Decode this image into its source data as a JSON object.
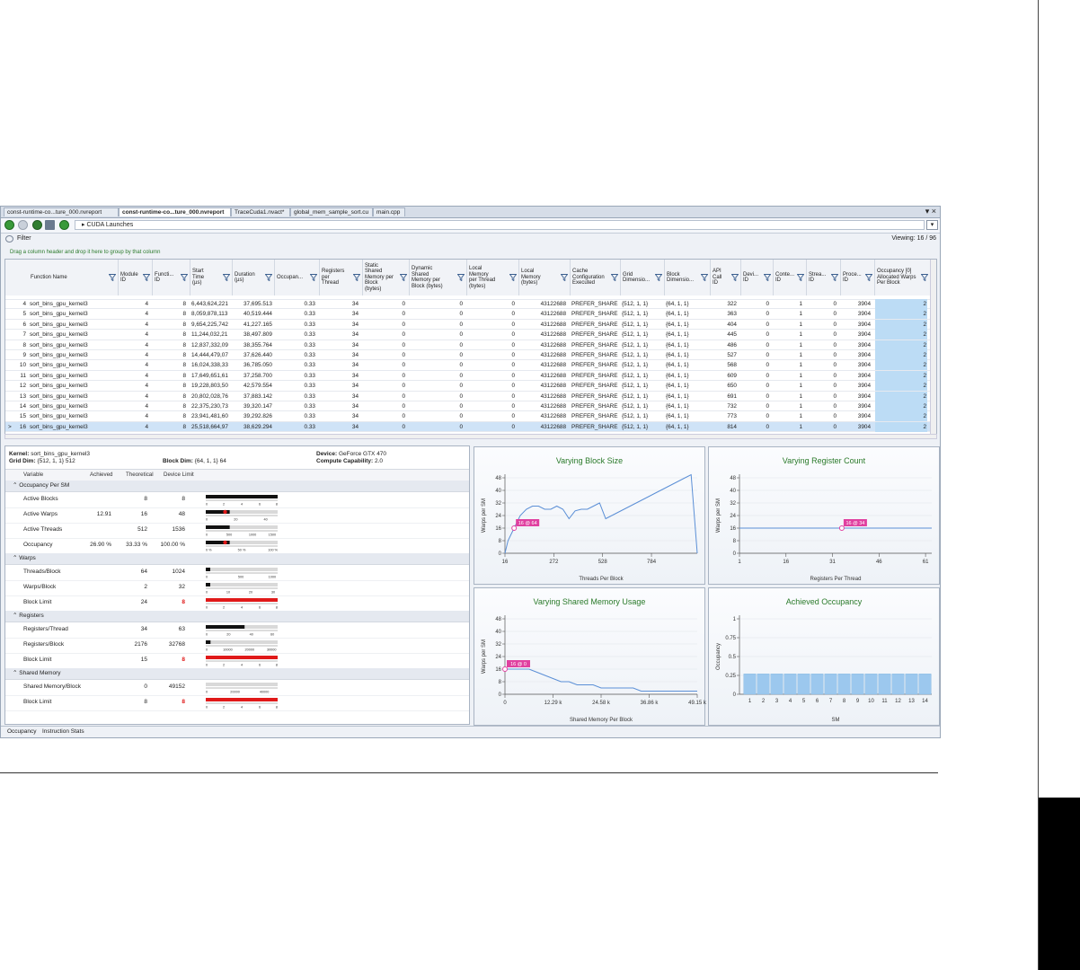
{
  "tabs": [
    {
      "label": "const-runtime-co...ture_000.nvreport",
      "active": false
    },
    {
      "label": "const-runtime-co...ture_000.nvreport",
      "active": true
    },
    {
      "label": "TraceCuda1.nvact*",
      "active": false
    },
    {
      "label": "global_mem_sample_sort.cu",
      "active": false
    },
    {
      "label": "main.cpp",
      "active": false
    }
  ],
  "window_controls": "▾ ×",
  "breadcrumb": "CUDA Launches",
  "filter": {
    "label": "Filter",
    "viewing": "Viewing: 16 / 96",
    "group_hint": "Drag a column header and drop it here to group by that column"
  },
  "grid": {
    "columns": [
      {
        "label": "Function Name"
      },
      {
        "label": "Module\nID"
      },
      {
        "label": "Functi...\nID"
      },
      {
        "label": "Start\nTime\n(µs)"
      },
      {
        "label": "Duration\n(µs)"
      },
      {
        "label": "Occupan..."
      },
      {
        "label": "Registers\nper\nThread"
      },
      {
        "label": "Static\nShared\nMemory per\nBlock\n(bytes)"
      },
      {
        "label": "Dynamic\nShared\nMemory per\nBlock (bytes)"
      },
      {
        "label": "Local\nMemory\nper Thread\n(bytes)"
      },
      {
        "label": "Local\nMemory\n(bytes)"
      },
      {
        "label": "Cache\nConfiguration\nExecuted"
      },
      {
        "label": "Grid\nDimensio..."
      },
      {
        "label": "Block\nDimensio..."
      },
      {
        "label": "API\nCall\nID"
      },
      {
        "label": "Devi...\nID"
      },
      {
        "label": "Conte...\nID"
      },
      {
        "label": "Strea...\nID"
      },
      {
        "label": "Proce...\nID"
      },
      {
        "label": "Occupancy [0]\nAllocated Warps\nPer Block"
      }
    ],
    "rows": [
      {
        "idx": "4",
        "fn": "sort_bins_gpu_kernel3",
        "mod": "4",
        "fid": "8",
        "start": "6,443,624,221",
        "dur": "37,695.513",
        "occ": "0.33",
        "reg": "34",
        "static": "0",
        "dyn": "0",
        "lpt": "0",
        "lm": "43122688",
        "cache": "PREFER_SHARE",
        "grid": "{512, 1, 1}",
        "block": "{64, 1, 1}",
        "api": "322",
        "dev": "0",
        "ctx": "1",
        "str": "0",
        "proc": "3904",
        "warps": "2"
      },
      {
        "idx": "5",
        "fn": "sort_bins_gpu_kernel3",
        "mod": "4",
        "fid": "8",
        "start": "8,059,878,113",
        "dur": "40,519.444",
        "occ": "0.33",
        "reg": "34",
        "static": "0",
        "dyn": "0",
        "lpt": "0",
        "lm": "43122688",
        "cache": "PREFER_SHARE",
        "grid": "{512, 1, 1}",
        "block": "{64, 1, 1}",
        "api": "363",
        "dev": "0",
        "ctx": "1",
        "str": "0",
        "proc": "3904",
        "warps": "2"
      },
      {
        "idx": "6",
        "fn": "sort_bins_gpu_kernel3",
        "mod": "4",
        "fid": "8",
        "start": "9,654,225,742",
        "dur": "41,227.165",
        "occ": "0.33",
        "reg": "34",
        "static": "0",
        "dyn": "0",
        "lpt": "0",
        "lm": "43122688",
        "cache": "PREFER_SHARE",
        "grid": "{512, 1, 1}",
        "block": "{64, 1, 1}",
        "api": "404",
        "dev": "0",
        "ctx": "1",
        "str": "0",
        "proc": "3904",
        "warps": "2"
      },
      {
        "idx": "7",
        "fn": "sort_bins_gpu_kernel3",
        "mod": "4",
        "fid": "8",
        "start": "11,244,032,21",
        "dur": "38,497.809",
        "occ": "0.33",
        "reg": "34",
        "static": "0",
        "dyn": "0",
        "lpt": "0",
        "lm": "43122688",
        "cache": "PREFER_SHARE",
        "grid": "{512, 1, 1}",
        "block": "{64, 1, 1}",
        "api": "445",
        "dev": "0",
        "ctx": "1",
        "str": "0",
        "proc": "3904",
        "warps": "2"
      },
      {
        "idx": "8",
        "fn": "sort_bins_gpu_kernel3",
        "mod": "4",
        "fid": "8",
        "start": "12,837,332,09",
        "dur": "38,355.764",
        "occ": "0.33",
        "reg": "34",
        "static": "0",
        "dyn": "0",
        "lpt": "0",
        "lm": "43122688",
        "cache": "PREFER_SHARE",
        "grid": "{512, 1, 1}",
        "block": "{64, 1, 1}",
        "api": "486",
        "dev": "0",
        "ctx": "1",
        "str": "0",
        "proc": "3904",
        "warps": "2"
      },
      {
        "idx": "9",
        "fn": "sort_bins_gpu_kernel3",
        "mod": "4",
        "fid": "8",
        "start": "14,444,479,07",
        "dur": "37,626.440",
        "occ": "0.33",
        "reg": "34",
        "static": "0",
        "dyn": "0",
        "lpt": "0",
        "lm": "43122688",
        "cache": "PREFER_SHARE",
        "grid": "{512, 1, 1}",
        "block": "{64, 1, 1}",
        "api": "527",
        "dev": "0",
        "ctx": "1",
        "str": "0",
        "proc": "3904",
        "warps": "2"
      },
      {
        "idx": "10",
        "fn": "sort_bins_gpu_kernel3",
        "mod": "4",
        "fid": "8",
        "start": "16,024,338,33",
        "dur": "36,785.050",
        "occ": "0.33",
        "reg": "34",
        "static": "0",
        "dyn": "0",
        "lpt": "0",
        "lm": "43122688",
        "cache": "PREFER_SHARE",
        "grid": "{512, 1, 1}",
        "block": "{64, 1, 1}",
        "api": "568",
        "dev": "0",
        "ctx": "1",
        "str": "0",
        "proc": "3904",
        "warps": "2"
      },
      {
        "idx": "11",
        "fn": "sort_bins_gpu_kernel3",
        "mod": "4",
        "fid": "8",
        "start": "17,649,651,61",
        "dur": "37,258.700",
        "occ": "0.33",
        "reg": "34",
        "static": "0",
        "dyn": "0",
        "lpt": "0",
        "lm": "43122688",
        "cache": "PREFER_SHARE",
        "grid": "{512, 1, 1}",
        "block": "{64, 1, 1}",
        "api": "609",
        "dev": "0",
        "ctx": "1",
        "str": "0",
        "proc": "3904",
        "warps": "2"
      },
      {
        "idx": "12",
        "fn": "sort_bins_gpu_kernel3",
        "mod": "4",
        "fid": "8",
        "start": "19,228,803,50",
        "dur": "42,579.554",
        "occ": "0.33",
        "reg": "34",
        "static": "0",
        "dyn": "0",
        "lpt": "0",
        "lm": "43122688",
        "cache": "PREFER_SHARE",
        "grid": "{512, 1, 1}",
        "block": "{64, 1, 1}",
        "api": "650",
        "dev": "0",
        "ctx": "1",
        "str": "0",
        "proc": "3904",
        "warps": "2"
      },
      {
        "idx": "13",
        "fn": "sort_bins_gpu_kernel3",
        "mod": "4",
        "fid": "8",
        "start": "20,802,028,76",
        "dur": "37,883.142",
        "occ": "0.33",
        "reg": "34",
        "static": "0",
        "dyn": "0",
        "lpt": "0",
        "lm": "43122688",
        "cache": "PREFER_SHARE",
        "grid": "{512, 1, 1}",
        "block": "{64, 1, 1}",
        "api": "691",
        "dev": "0",
        "ctx": "1",
        "str": "0",
        "proc": "3904",
        "warps": "2"
      },
      {
        "idx": "14",
        "fn": "sort_bins_gpu_kernel3",
        "mod": "4",
        "fid": "8",
        "start": "22,375,230,73",
        "dur": "39,320.147",
        "occ": "0.33",
        "reg": "34",
        "static": "0",
        "dyn": "0",
        "lpt": "0",
        "lm": "43122688",
        "cache": "PREFER_SHARE",
        "grid": "{512, 1, 1}",
        "block": "{64, 1, 1}",
        "api": "732",
        "dev": "0",
        "ctx": "1",
        "str": "0",
        "proc": "3904",
        "warps": "2"
      },
      {
        "idx": "15",
        "fn": "sort_bins_gpu_kernel3",
        "mod": "4",
        "fid": "8",
        "start": "23,941,481,60",
        "dur": "39,292.826",
        "occ": "0.33",
        "reg": "34",
        "static": "0",
        "dyn": "0",
        "lpt": "0",
        "lm": "43122688",
        "cache": "PREFER_SHARE",
        "grid": "{512, 1, 1}",
        "block": "{64, 1, 1}",
        "api": "773",
        "dev": "0",
        "ctx": "1",
        "str": "0",
        "proc": "3904",
        "warps": "2"
      },
      {
        "idx": "16",
        "fn": "sort_bins_gpu_kernel3",
        "mod": "4",
        "fid": "8",
        "start": "25,518,664,97",
        "dur": "38,629.294",
        "occ": "0.33",
        "reg": "34",
        "static": "0",
        "dyn": "0",
        "lpt": "0",
        "lm": "43122688",
        "cache": "PREFER_SHARE",
        "grid": "{512, 1, 1}",
        "block": "{64, 1, 1}",
        "api": "814",
        "dev": "0",
        "ctx": "1",
        "str": "0",
        "proc": "3904",
        "warps": "2",
        "selected": true
      }
    ]
  },
  "details": {
    "kernel_label": "Kernel:",
    "kernel": "sort_bins_gpu_kernel3",
    "grid_label": "Grid Dim:",
    "grid": "{512, 1, 1} 512",
    "block_label": "Block Dim:",
    "block": "{64, 1, 1} 64",
    "device_label": "Device:",
    "device": "GeForce GTX 470",
    "cc_label": "Compute Capability:",
    "cc": "2.0",
    "headers": {
      "variable": "Variable",
      "achieved": "Achieved",
      "theoretical": "Theoretical",
      "limit": "Device Limit"
    },
    "sections": [
      {
        "title": "Occupancy Per SM",
        "rows": [
          {
            "name": "Active Blocks",
            "achieved": "",
            "theoretical": "8",
            "limit": "8",
            "limit_red": false,
            "axis_max": 8,
            "ticks": [
              "0",
              "2",
              "4",
              "6",
              "8"
            ],
            "fill": 1.0,
            "marker": null
          },
          {
            "name": "Active Warps",
            "achieved": "12.91",
            "theoretical": "16",
            "limit": "48",
            "limit_red": false,
            "axis_max": 48,
            "ticks": [
              "0",
              "20",
              "40"
            ],
            "fill": 0.333,
            "marker": 0.269
          },
          {
            "name": "Active Threads",
            "achieved": "",
            "theoretical": "512",
            "limit": "1536",
            "limit_red": false,
            "axis_max": 1536,
            "ticks": [
              "0",
              "500",
              "1000",
              "1500"
            ],
            "fill": 0.333,
            "marker": null
          },
          {
            "name": "Occupancy",
            "achieved": "26.90 %",
            "theoretical": "33.33 %",
            "limit": "100.00 %",
            "limit_red": false,
            "axis_max": 100,
            "ticks": [
              "0 %",
              "50 %",
              "100 %"
            ],
            "fill": 0.333,
            "marker": 0.269
          }
        ]
      },
      {
        "title": "Warps",
        "rows": [
          {
            "name": "Threads/Block",
            "achieved": "",
            "theoretical": "64",
            "limit": "1024",
            "limit_red": false,
            "axis_max": 1024,
            "ticks": [
              "0",
              "500",
              "1000"
            ],
            "fill": 0.0625,
            "marker": null
          },
          {
            "name": "Warps/Block",
            "achieved": "",
            "theoretical": "2",
            "limit": "32",
            "limit_red": false,
            "axis_max": 32,
            "ticks": [
              "0",
              "10",
              "20",
              "30"
            ],
            "fill": 0.0625,
            "marker": null
          },
          {
            "name": "Block Limit",
            "achieved": "",
            "theoretical": "24",
            "limit": "8",
            "limit_red": true,
            "axis_max": 8,
            "ticks": [
              "0",
              "2",
              "4",
              "6",
              "8"
            ],
            "fill": 1.0,
            "marker": null,
            "red": true
          }
        ]
      },
      {
        "title": "Registers",
        "rows": [
          {
            "name": "Registers/Thread",
            "achieved": "",
            "theoretical": "34",
            "limit": "63",
            "limit_red": false,
            "axis_max": 63,
            "ticks": [
              "0",
              "20",
              "40",
              "60"
            ],
            "fill": 0.54,
            "marker": null
          },
          {
            "name": "Registers/Block",
            "achieved": "",
            "theoretical": "2176",
            "limit": "32768",
            "limit_red": false,
            "axis_max": 32768,
            "ticks": [
              "0",
              "10000",
              "20000",
              "30000"
            ],
            "fill": 0.066,
            "marker": null
          },
          {
            "name": "Block Limit",
            "achieved": "",
            "theoretical": "15",
            "limit": "8",
            "limit_red": true,
            "axis_max": 8,
            "ticks": [
              "0",
              "2",
              "4",
              "6",
              "8"
            ],
            "fill": 1.0,
            "marker": null,
            "red": true
          }
        ]
      },
      {
        "title": "Shared Memory",
        "rows": [
          {
            "name": "Shared Memory/Block",
            "achieved": "",
            "theoretical": "0",
            "limit": "49152",
            "limit_red": false,
            "axis_max": 49152,
            "ticks": [
              "0",
              "20000",
              "40000"
            ],
            "fill": 0.0,
            "marker": null
          },
          {
            "name": "Block Limit",
            "achieved": "",
            "theoretical": "8",
            "limit": "8",
            "limit_red": true,
            "axis_max": 8,
            "ticks": [
              "0",
              "2",
              "4",
              "6",
              "8"
            ],
            "fill": 1.0,
            "marker": null,
            "red": true
          }
        ]
      }
    ],
    "bottom_tabs": [
      "Occupancy",
      "Instruction Stats"
    ]
  },
  "colors": {
    "accent_line": "#5b8fd6",
    "marker": "#e040a0",
    "bar": "#9cc8ee",
    "title_green": "#2a7a2a",
    "limit_red": "#e01919"
  },
  "chart_data": [
    {
      "type": "line",
      "title": "Varying Block Size",
      "xlabel": "Threads Per Block",
      "ylabel": "Warps per SM",
      "xlim": [
        16,
        1024
      ],
      "ylim": [
        0,
        48
      ],
      "xticks": [
        "16",
        "272",
        "528",
        "784"
      ],
      "xtick_values": [
        16,
        272,
        528,
        784
      ],
      "yticks": [
        "0",
        "8",
        "16",
        "24",
        "32",
        "40",
        "48"
      ],
      "x": [
        16,
        32,
        48,
        64,
        96,
        128,
        160,
        192,
        224,
        256,
        288,
        320,
        352,
        384,
        416,
        448,
        480,
        512,
        544,
        576,
        608,
        640,
        672,
        704,
        736,
        768,
        800,
        832,
        864,
        896,
        928,
        960,
        992,
        1024
      ],
      "y": [
        0,
        8,
        12,
        16,
        24,
        28,
        30,
        30,
        28,
        28,
        30,
        28,
        22,
        27,
        28,
        28,
        30,
        32,
        22,
        24,
        26,
        28,
        30,
        32,
        34,
        36,
        38,
        40,
        42,
        44,
        46,
        48,
        50,
        0
      ],
      "annotation": {
        "x": 64,
        "y": 16,
        "label": "16 @ 64"
      }
    },
    {
      "type": "line",
      "title": "Varying Register Count",
      "xlabel": "Registers Per Thread",
      "ylabel": "Warps per SM",
      "xlim": [
        1,
        63
      ],
      "ylim": [
        0,
        48
      ],
      "xticks": [
        "1",
        "16",
        "31",
        "46",
        "61"
      ],
      "xtick_values": [
        1,
        16,
        31,
        46,
        61
      ],
      "yticks": [
        "0",
        "8",
        "16",
        "24",
        "32",
        "40",
        "48"
      ],
      "x": [
        1,
        63
      ],
      "y": [
        16,
        16
      ],
      "annotation": {
        "x": 34,
        "y": 16,
        "label": "16 @ 34"
      }
    },
    {
      "type": "line",
      "title": "Varying Shared Memory Usage",
      "xlabel": "Shared Memory Per Block",
      "ylabel": "Warps per SM",
      "xlim": [
        0,
        49152
      ],
      "ylim": [
        0,
        48
      ],
      "xticks": [
        "0",
        "12.29 k",
        "24.58 k",
        "36.86 k",
        "49.15 k"
      ],
      "xtick_values": [
        0,
        12288,
        24576,
        36864,
        49152
      ],
      "yticks": [
        "0",
        "8",
        "16",
        "24",
        "32",
        "40",
        "48"
      ],
      "x": [
        0,
        6144,
        8192,
        10240,
        12288,
        14336,
        16384,
        18432,
        20480,
        22528,
        24576,
        26624,
        28672,
        30720,
        32768,
        34816,
        36864,
        38912,
        40960,
        43008,
        45056,
        47104,
        49152
      ],
      "y": [
        16,
        16,
        14,
        12,
        10,
        8,
        8,
        6,
        6,
        6,
        4,
        4,
        4,
        4,
        4,
        2,
        2,
        2,
        2,
        2,
        2,
        2,
        2
      ],
      "annotation": {
        "x": 0,
        "y": 16,
        "label": "16 @ 0"
      }
    },
    {
      "type": "bar",
      "title": "Achieved Occupancy",
      "xlabel": "SM",
      "ylabel": "Occupancy",
      "ylim": [
        0,
        1
      ],
      "yticks": [
        "0",
        "0.25",
        "0.5",
        "0.75",
        "1"
      ],
      "categories": [
        "1",
        "2",
        "3",
        "4",
        "5",
        "6",
        "7",
        "8",
        "9",
        "10",
        "11",
        "12",
        "13",
        "14"
      ],
      "values": [
        0.27,
        0.27,
        0.27,
        0.27,
        0.27,
        0.27,
        0.27,
        0.27,
        0.27,
        0.27,
        0.27,
        0.27,
        0.27,
        0.27
      ]
    }
  ]
}
